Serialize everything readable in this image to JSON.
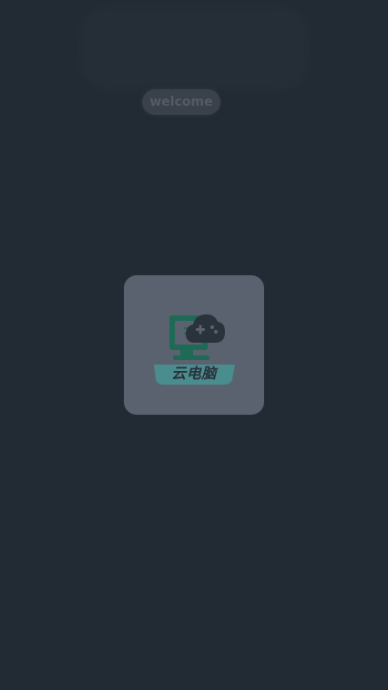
{
  "welcome": {
    "label": "welcome"
  },
  "splash": {
    "app_name": "云电脑",
    "icon": "cloud-gamepad-icon"
  },
  "colors": {
    "background": "#222a33",
    "card": "#5a6270",
    "accent_green": "#1f6a55",
    "accent_teal": "#4a8d8f"
  }
}
